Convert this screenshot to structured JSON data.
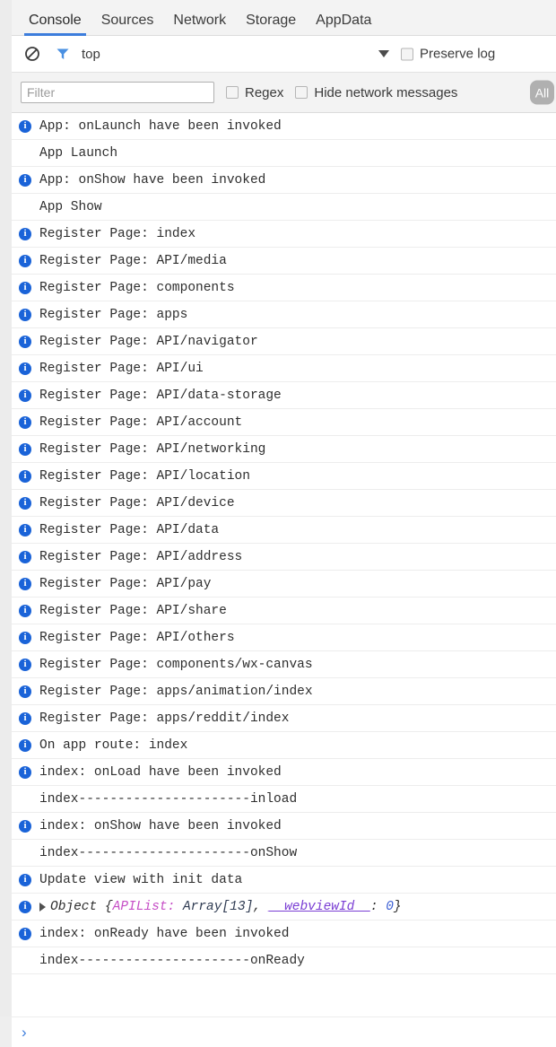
{
  "window": {
    "title": "Developer Tools Console",
    "accent_color": "#3c7ddc",
    "info_color": "#1a63d8"
  },
  "tabs": [
    {
      "label": "Console",
      "active": true
    },
    {
      "label": "Sources",
      "active": false
    },
    {
      "label": "Network",
      "active": false
    },
    {
      "label": "Storage",
      "active": false
    },
    {
      "label": "AppData",
      "active": false
    }
  ],
  "toolbar": {
    "clear_icon": "clear-console-icon",
    "filter_icon": "filter-funnel-icon",
    "context_label": "top",
    "context_caret": "chevron-down-icon",
    "preserve_log_label": "Preserve log",
    "preserve_log_checked": false
  },
  "filterbar": {
    "filter_placeholder": "Filter",
    "filter_value": "",
    "regex_label": "Regex",
    "regex_checked": false,
    "hide_network_label": "Hide network messages",
    "hide_network_checked": false,
    "level_badge": "All"
  },
  "log": [
    {
      "icon": "info",
      "text": "App: onLaunch have been invoked"
    },
    {
      "icon": "none",
      "text": "App Launch"
    },
    {
      "icon": "info",
      "text": "App: onShow have been invoked"
    },
    {
      "icon": "none",
      "text": "App Show"
    },
    {
      "icon": "info",
      "text": "Register Page: index"
    },
    {
      "icon": "info",
      "text": "Register Page: API/media"
    },
    {
      "icon": "info",
      "text": "Register Page: components"
    },
    {
      "icon": "info",
      "text": "Register Page: apps"
    },
    {
      "icon": "info",
      "text": "Register Page: API/navigator"
    },
    {
      "icon": "info",
      "text": "Register Page: API/ui"
    },
    {
      "icon": "info",
      "text": "Register Page: API/data-storage"
    },
    {
      "icon": "info",
      "text": "Register Page: API/account"
    },
    {
      "icon": "info",
      "text": "Register Page: API/networking"
    },
    {
      "icon": "info",
      "text": "Register Page: API/location"
    },
    {
      "icon": "info",
      "text": "Register Page: API/device"
    },
    {
      "icon": "info",
      "text": "Register Page: API/data"
    },
    {
      "icon": "info",
      "text": "Register Page: API/address"
    },
    {
      "icon": "info",
      "text": "Register Page: API/pay"
    },
    {
      "icon": "info",
      "text": "Register Page: API/share"
    },
    {
      "icon": "info",
      "text": "Register Page: API/others"
    },
    {
      "icon": "info",
      "text": "Register Page: components/wx-canvas"
    },
    {
      "icon": "info",
      "text": "Register Page: apps/animation/index"
    },
    {
      "icon": "info",
      "text": "Register Page: apps/reddit/index"
    },
    {
      "icon": "info",
      "text": "On app route: index"
    },
    {
      "icon": "info",
      "text": "index: onLoad have been invoked"
    },
    {
      "icon": "none",
      "text": "index----------------------inload"
    },
    {
      "icon": "info",
      "text": "index: onShow have been invoked"
    },
    {
      "icon": "none",
      "text": "index----------------------onShow"
    },
    {
      "icon": "info",
      "text": "Update view with init data"
    },
    {
      "icon": "info",
      "type": "object",
      "object": {
        "disclosure": "collapsed",
        "name": "Object",
        "open_brace": " {",
        "key1": "APIList:",
        "val1": " Array[13]",
        "comma": ", ",
        "key2": "__webviewId__",
        "colon": ": ",
        "val2": "0",
        "close_brace": "}"
      }
    },
    {
      "icon": "info",
      "text": "index: onReady have been invoked"
    },
    {
      "icon": "none",
      "text": "index----------------------onReady"
    }
  ],
  "prompt": {
    "chevron": "›"
  }
}
